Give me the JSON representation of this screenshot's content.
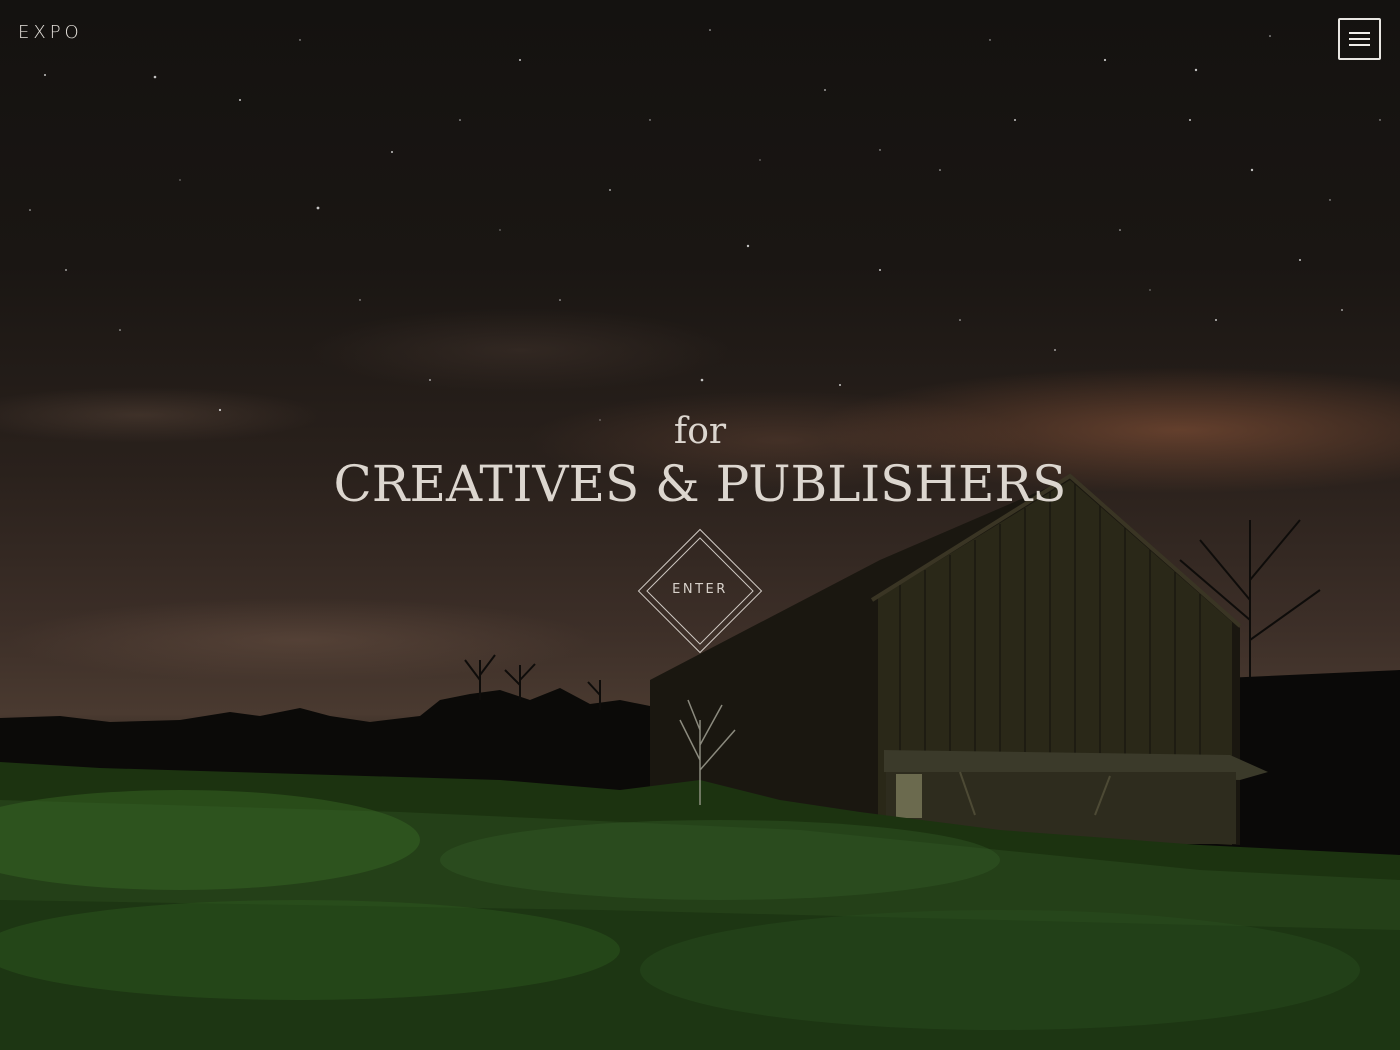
{
  "header": {
    "brand": "EXPO",
    "menu_icon": "hamburger-menu-icon"
  },
  "hero": {
    "tagline_small": "for",
    "tagline_big": "CREATIVES & PUBLISHERS",
    "enter_label": "ENTER",
    "enter_icon": "diamond-frame"
  },
  "colors": {
    "text": "#dcd6cf",
    "sky_top": "#141210",
    "glow": "#96593c",
    "grass": "#2f5a1f"
  }
}
